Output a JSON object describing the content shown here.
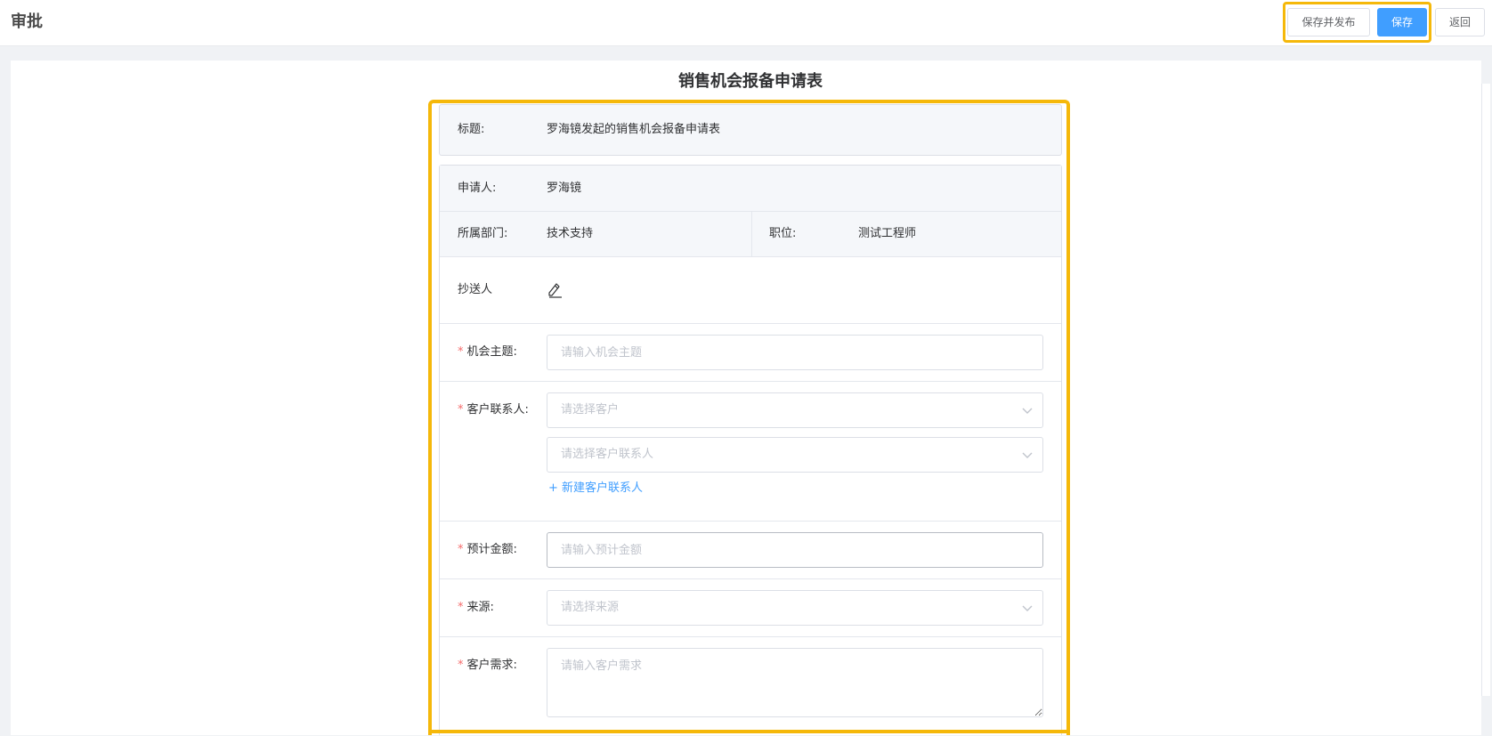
{
  "header": {
    "title": "审批",
    "buttons": {
      "save_publish": "保存并发布",
      "save": "保存",
      "back": "返回"
    }
  },
  "form": {
    "title": "销售机会报备申请表",
    "title_row": {
      "label": "标题:",
      "value": "罗海镜发起的销售机会报备申请表"
    },
    "applicant": {
      "label": "申请人:",
      "value": "罗海镜"
    },
    "department": {
      "label": "所属部门:",
      "value": "技术支持"
    },
    "position": {
      "label": "职位:",
      "value": "测试工程师"
    },
    "cc": {
      "label": "抄送人",
      "icon": "edit-icon"
    },
    "opportunity_subject": {
      "required_mark": "*",
      "label": "机会主题:",
      "value": "",
      "placeholder": "请输入机会主题"
    },
    "customer_contact": {
      "required_mark": "*",
      "label": "客户联系人:",
      "customer_placeholder": "请选择客户",
      "contact_placeholder": "请选择客户联系人",
      "new_contact_link": "+ 新建客户联系人"
    },
    "estimated_amount": {
      "required_mark": "*",
      "label": "预计金额:",
      "value": "",
      "placeholder": "请输入预计金额"
    },
    "source": {
      "required_mark": "*",
      "label": "来源:",
      "placeholder": "请选择来源"
    },
    "customer_demand": {
      "required_mark": "*",
      "label": "客户需求:",
      "value": "",
      "placeholder": "请输入客户需求"
    }
  },
  "colors": {
    "primary": "#409eff",
    "highlight": "#f5b80a",
    "required": "#f56c6c",
    "placeholder": "#c0c4cc"
  }
}
